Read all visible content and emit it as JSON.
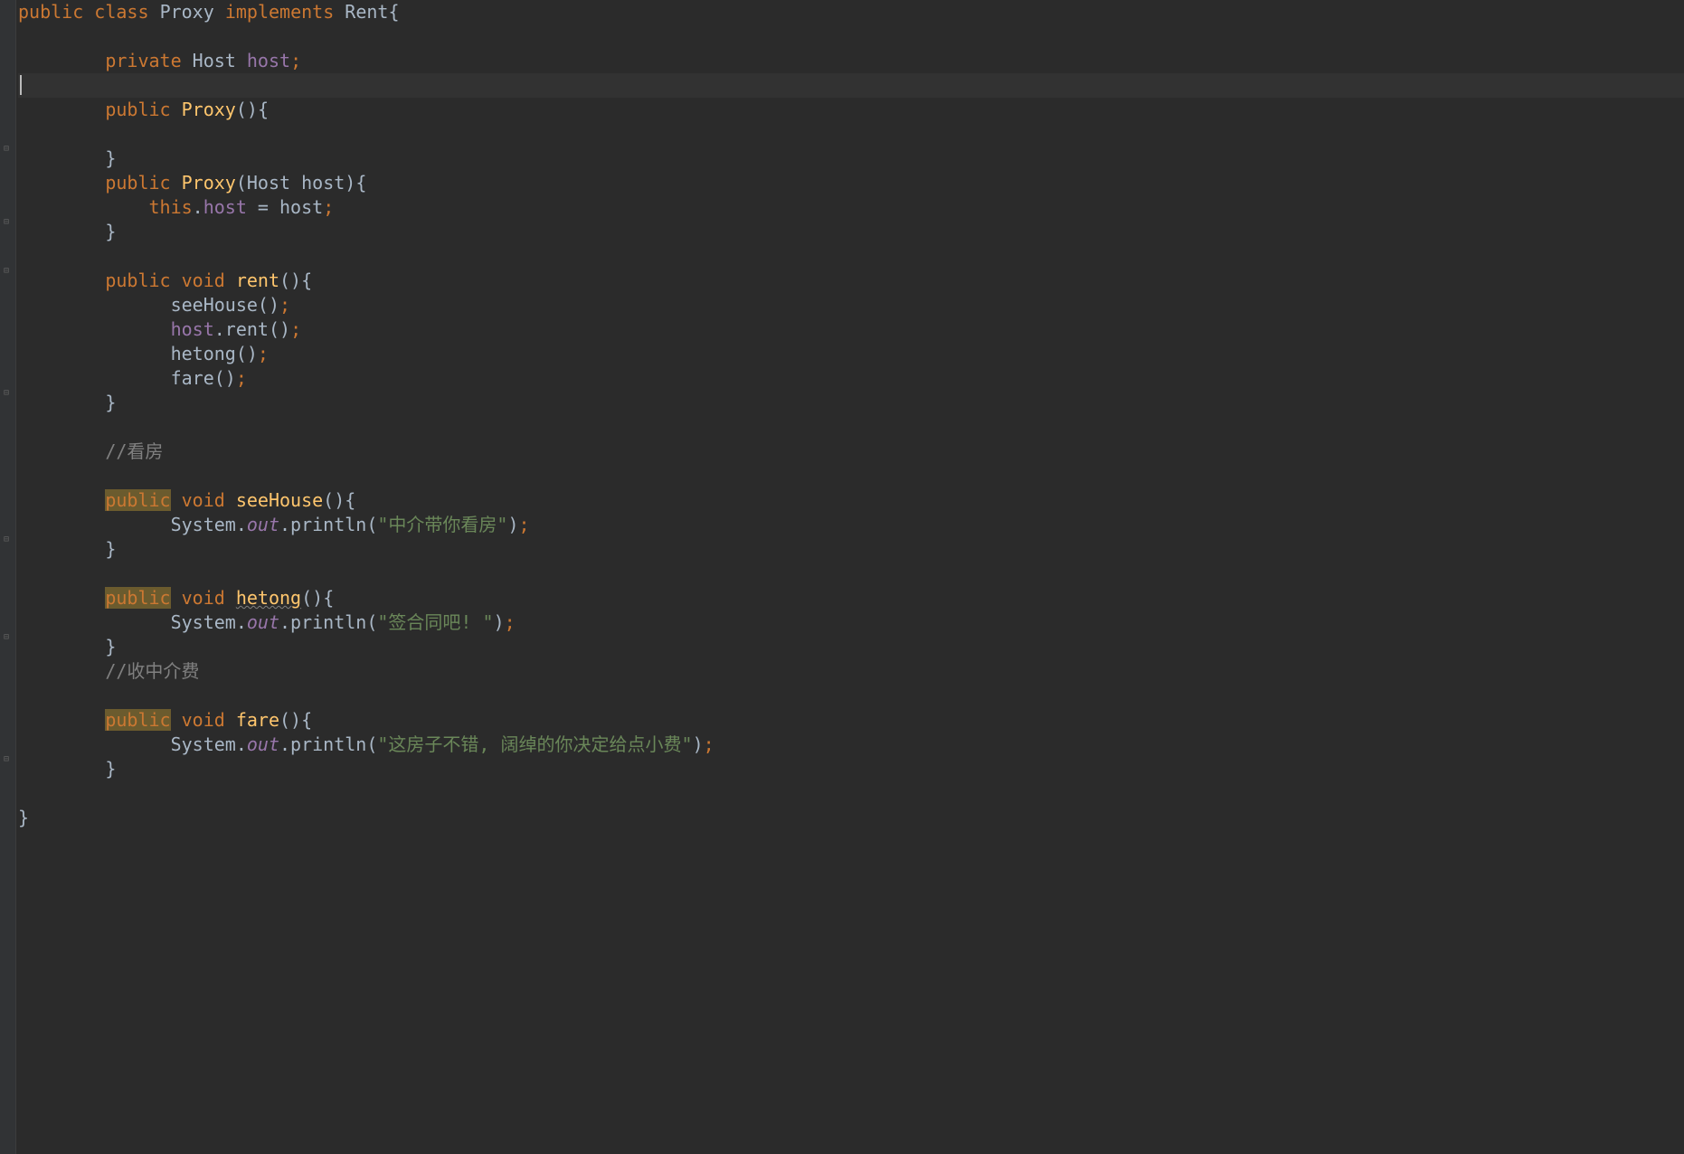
{
  "code": {
    "line1": {
      "kw_public": "public",
      "kw_class": "class",
      "class_name": "Proxy",
      "kw_implements": "implements",
      "interface_name": "Rent",
      "brace_open": "{"
    },
    "line3": {
      "kw_private": "private",
      "type": "Host",
      "field": "host",
      "semi": ";"
    },
    "line5": {
      "kw_public": "public",
      "constructor": "Proxy",
      "parens": "()",
      "brace_open": "{"
    },
    "line7": {
      "brace_close": "}"
    },
    "line8": {
      "kw_public": "public",
      "constructor": "Proxy",
      "paren_open": "(",
      "param_type": "Host",
      "param_name": "host",
      "paren_close": ")",
      "brace_open": "{"
    },
    "line9": {
      "kw_this": "this",
      "dot": ".",
      "field": "host",
      "equals": " = ",
      "param": "host",
      "semi": ";"
    },
    "line10": {
      "brace_close": "}"
    },
    "line12": {
      "kw_public": "public",
      "kw_void": "void",
      "method": "rent",
      "parens": "()",
      "brace_open": "{"
    },
    "line13": {
      "method_call": "seeHouse",
      "parens": "()",
      "semi": ";"
    },
    "line14": {
      "field": "host",
      "dot": ".",
      "method_call": "rent",
      "parens": "()",
      "semi": ";"
    },
    "line15": {
      "method_call": "hetong",
      "parens": "()",
      "semi": ";"
    },
    "line16": {
      "method_call": "fare",
      "parens": "()",
      "semi": ";"
    },
    "line17": {
      "brace_close": "}"
    },
    "line19": {
      "comment": "//看房"
    },
    "line21": {
      "kw_public": "public",
      "kw_void": "void",
      "method": "seeHouse",
      "parens": "()",
      "brace_open": "{"
    },
    "line22": {
      "class_ref": "System",
      "dot1": ".",
      "field": "out",
      "dot2": ".",
      "method_call": "println",
      "paren_open": "(",
      "string": "\"中介带你看房\"",
      "paren_close": ")",
      "semi": ";"
    },
    "line23": {
      "brace_close": "}"
    },
    "line25": {
      "kw_public": "public",
      "kw_void": "void",
      "method": "hetong",
      "parens": "()",
      "brace_open": "{"
    },
    "line26": {
      "class_ref": "System",
      "dot1": ".",
      "field": "out",
      "dot2": ".",
      "method_call": "println",
      "paren_open": "(",
      "string": "\"签合同吧! \"",
      "paren_close": ")",
      "semi": ";"
    },
    "line27": {
      "brace_close": "}"
    },
    "line28": {
      "comment": "//收中介费"
    },
    "line30": {
      "kw_public": "public",
      "kw_void": "void",
      "method": "fare",
      "parens": "()",
      "brace_open": "{"
    },
    "line31": {
      "class_ref": "System",
      "dot1": ".",
      "field": "out",
      "dot2": ".",
      "method_call": "println",
      "paren_open": "(",
      "string": "\"这房子不错, 阔绰的你决定给点小费\"",
      "paren_close": ")",
      "semi": ";"
    },
    "line32": {
      "brace_close": "}"
    },
    "line34": {
      "brace_close": "}"
    }
  }
}
